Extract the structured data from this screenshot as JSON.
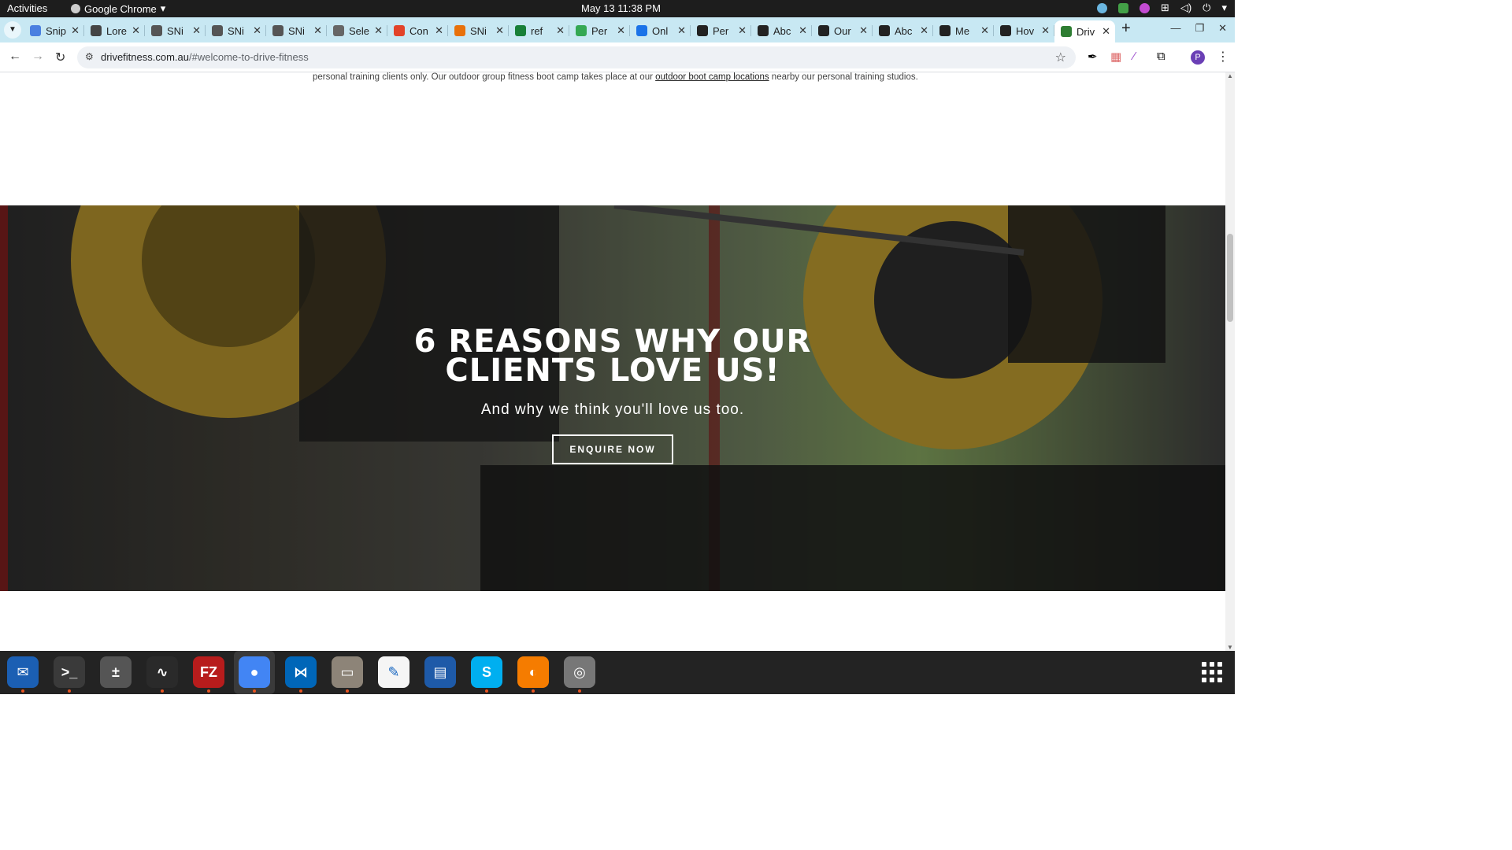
{
  "topbar": {
    "activities": "Activities",
    "app_name": "Google Chrome",
    "clock": "May 13  11:38 PM"
  },
  "tabs": [
    {
      "title": "Snip",
      "icon": "docs-icon",
      "color": "#4a7fe0"
    },
    {
      "title": "Lore",
      "icon": "lorem-icon",
      "color": "#444444"
    },
    {
      "title": "SNi",
      "icon": "snp-icon",
      "color": "#555555"
    },
    {
      "title": "SNi",
      "icon": "snp-icon",
      "color": "#555555"
    },
    {
      "title": "SNi",
      "icon": "snp-icon",
      "color": "#555555"
    },
    {
      "title": "Sele",
      "icon": "globe-icon",
      "color": "#666666"
    },
    {
      "title": "Con",
      "icon": "gitlab-icon",
      "color": "#e24329"
    },
    {
      "title": "SNi",
      "icon": "snp-color-icon",
      "color": "#e8710a"
    },
    {
      "title": "ref",
      "icon": "sheets-icon",
      "color": "#188038"
    },
    {
      "title": "Per",
      "icon": "leaf-icon",
      "color": "#34a853"
    },
    {
      "title": "Onl",
      "icon": "info-icon",
      "color": "#1a73e8"
    },
    {
      "title": "Per",
      "icon": "openai-icon",
      "color": "#222222"
    },
    {
      "title": "Abc",
      "icon": "openai-icon",
      "color": "#222222"
    },
    {
      "title": "Our",
      "icon": "openai-icon",
      "color": "#222222"
    },
    {
      "title": "Abc",
      "icon": "openai-icon",
      "color": "#222222"
    },
    {
      "title": "Me",
      "icon": "openai-icon",
      "color": "#222222"
    },
    {
      "title": "Hov",
      "icon": "openai-icon",
      "color": "#222222"
    },
    {
      "title": "Driv",
      "icon": "drive-fitness-icon",
      "color": "#2e7d32",
      "active": true
    }
  ],
  "address_bar": {
    "domain": "drivefitness.com.au",
    "path": "/#welcome-to-drive-fitness"
  },
  "page": {
    "intro_before": "personal training clients only. Our outdoor group fitness boot camp takes place at our ",
    "intro_link": "outdoor boot camp locations",
    "intro_after": " nearby our personal training studios.",
    "hero": {
      "title_line1": "6 REASONS WHY OUR",
      "title_line2": "CLIENTS LOVE US!",
      "subtitle": "And why we think you'll love us too.",
      "button": "ENQUIRE NOW"
    }
  },
  "profile": {
    "initial": "P"
  },
  "dock": [
    {
      "name": "thunderbird-icon",
      "bg": "#1b5fb3",
      "glyph": "✉"
    },
    {
      "name": "terminal-icon",
      "bg": "#3a3a3a",
      "glyph": ">_"
    },
    {
      "name": "calculator-icon",
      "bg": "#555555",
      "glyph": "±"
    },
    {
      "name": "system-monitor-icon",
      "bg": "#2a2a2a",
      "glyph": "∿"
    },
    {
      "name": "filezilla-icon",
      "bg": "#b71c1c",
      "glyph": "FZ"
    },
    {
      "name": "chrome-icon",
      "bg": "#4285f4",
      "glyph": "●"
    },
    {
      "name": "vscode-icon",
      "bg": "#0066b8",
      "glyph": "⋈"
    },
    {
      "name": "files-icon",
      "bg": "#8d8478",
      "glyph": "▭"
    },
    {
      "name": "text-editor-icon",
      "bg": "#f5f5f5",
      "glyph": "✎"
    },
    {
      "name": "document-viewer-icon",
      "bg": "#1e5aa8",
      "glyph": "▤"
    },
    {
      "name": "skype-icon",
      "bg": "#00aff0",
      "glyph": "S"
    },
    {
      "name": "burner-icon",
      "bg": "#f57c00",
      "glyph": "◐"
    },
    {
      "name": "disk-icon",
      "bg": "#777777",
      "glyph": "◎"
    }
  ]
}
